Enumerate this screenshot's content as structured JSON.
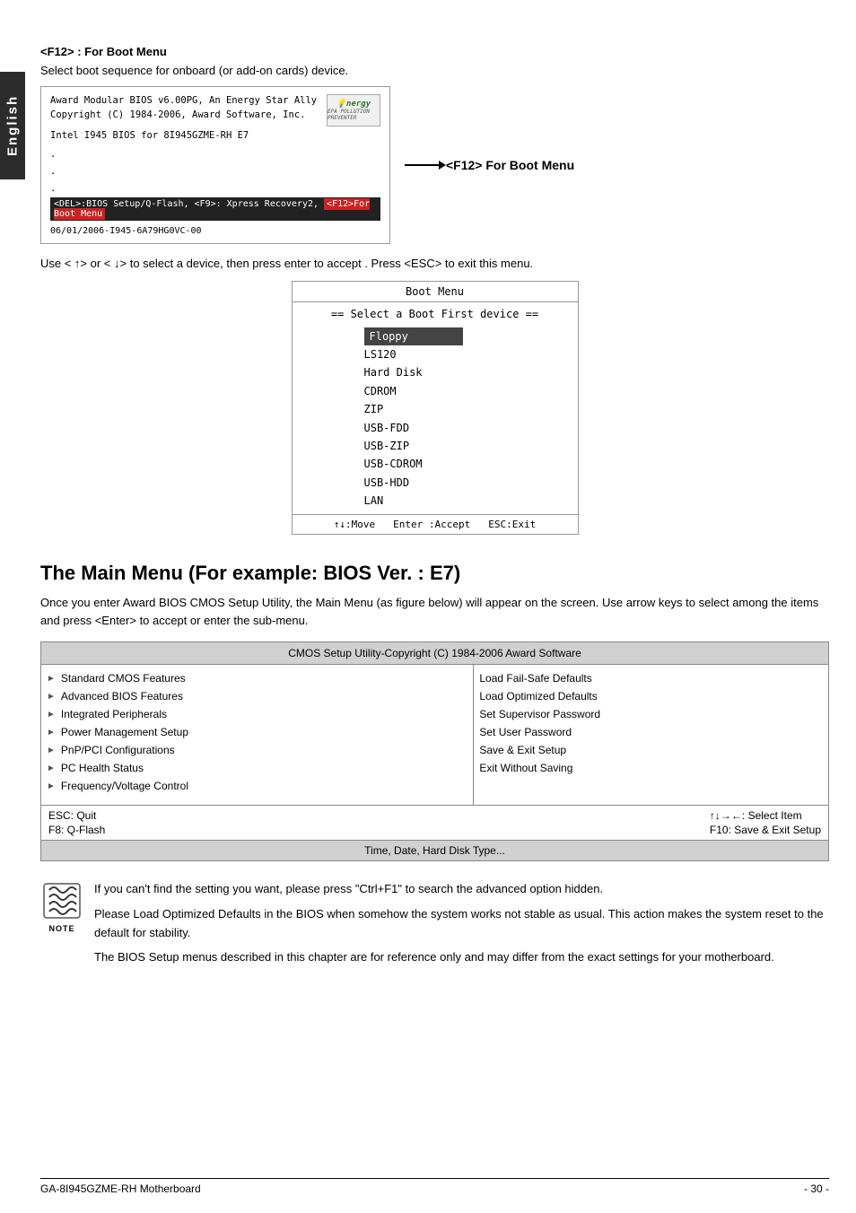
{
  "side_tab": {
    "label": "English"
  },
  "f12_section": {
    "title": "<F12> : For Boot Menu",
    "description": "Select boot sequence for onboard (or add-on cards) device.",
    "bios_screen": {
      "line1": "Award Modular BIOS v6.00PG, An Energy Star Ally",
      "line2": "Copyright (C) 1984-2006, Award Software, Inc.",
      "line3": "Intel I945 BIOS for 8I945GZME-RH E7",
      "dot1": ".",
      "dot2": ".",
      "dot3": ".",
      "del_line": "<DEL>:BIOS Setup/Q-Flash, <F9>: Xpress Recovery2, <F12>For Boot Menu",
      "del_highlight": "<F12>For Boot Menu",
      "bottom_line": "06/01/2006-I945-6A79HG0VC-00"
    },
    "energy_logo": {
      "text": "nergy",
      "epa": "EPA POLLUTION PREVENTER"
    },
    "f12_label": "<F12> For Boot Menu",
    "use_line": "Use < ↑> or < ↓> to select a device, then press enter to accept .  Press <ESC> to exit this menu."
  },
  "boot_menu": {
    "title": "Boot Menu",
    "select_line": "==  Select a Boot First device  ==",
    "items": [
      {
        "label": "Floppy",
        "selected": true
      },
      {
        "label": "LS120",
        "selected": false
      },
      {
        "label": "Hard Disk",
        "selected": false
      },
      {
        "label": "CDROM",
        "selected": false
      },
      {
        "label": "ZIP",
        "selected": false
      },
      {
        "label": "USB-FDD",
        "selected": false
      },
      {
        "label": "USB-ZIP",
        "selected": false
      },
      {
        "label": "USB-CDROM",
        "selected": false
      },
      {
        "label": "USB-HDD",
        "selected": false
      },
      {
        "label": "LAN",
        "selected": false
      }
    ],
    "footer": {
      "move": "↑↓:Move",
      "accept": "Enter :Accept",
      "exit": "ESC:Exit"
    }
  },
  "main_menu": {
    "heading": "The Main Menu (For example: BIOS Ver. : E7)",
    "description": "Once you enter Award BIOS CMOS Setup Utility, the Main Menu (as figure below) will appear on the screen.  Use arrow keys to select among the items and press <Enter> to accept or enter the sub-menu.",
    "cmos_title": "CMOS Setup Utility-Copyright (C) 1984-2006 Award Software",
    "left_items": [
      "Standard CMOS Features",
      "Advanced BIOS Features",
      "Integrated Peripherals",
      "Power Management Setup",
      "PnP/PCI Configurations",
      "PC Health Status",
      "Frequency/Voltage Control"
    ],
    "right_items": [
      "Load Fail-Safe Defaults",
      "Load Optimized Defaults",
      "Set Supervisor Password",
      "Set User Password",
      "Save & Exit Setup",
      "Exit Without Saving"
    ],
    "footer_left": [
      "ESC: Quit",
      "F8: Q-Flash"
    ],
    "footer_right": [
      "↑↓→←: Select Item",
      "F10: Save & Exit Setup"
    ],
    "status_bar": "Time, Date, Hard Disk Type..."
  },
  "note_section": {
    "note_label": "NOTE",
    "paragraphs": [
      "If you can't find the setting you want, please press \"Ctrl+F1\" to search the advanced option hidden.",
      "Please Load Optimized Defaults in the BIOS when somehow the system works not stable as usual. This action makes the system reset to the default for stability.",
      "The BIOS Setup menus described in this chapter are for reference only and may differ from the exact settings for your motherboard."
    ]
  },
  "footer": {
    "left": "GA-8I945GZME-RH Motherboard",
    "right": "- 30 -"
  }
}
